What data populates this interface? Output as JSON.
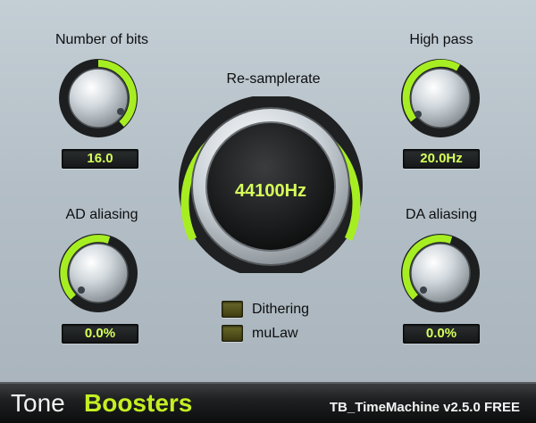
{
  "controls": {
    "bits": {
      "label": "Number of bits",
      "value": "16.0",
      "level": 0.42
    },
    "highpass": {
      "label": "High pass",
      "value": "20.0Hz",
      "level": 0.05
    },
    "ad_aliasing": {
      "label": "AD aliasing",
      "value": "0.0%",
      "level": 0.0
    },
    "da_aliasing": {
      "label": "DA aliasing",
      "value": "0.0%",
      "level": 0.0
    },
    "resample": {
      "label": "Re-samplerate",
      "value": "44100Hz",
      "level": 1.0
    }
  },
  "options": {
    "dithering": {
      "label": "Dithering",
      "checked": false
    },
    "mulaw": {
      "label": "muLaw",
      "checked": false
    }
  },
  "footer": {
    "brand_part1": "Tone",
    "brand_part2": "Boosters",
    "product": "TB_TimeMachine v2.5.0 FREE"
  },
  "colors": {
    "accent": "#a6ee22",
    "readout_text": "#d6ff5a",
    "panel": "#b7c2ca"
  }
}
